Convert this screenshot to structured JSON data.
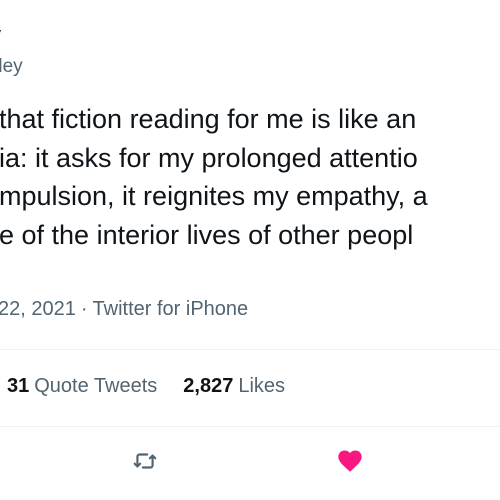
{
  "author": {
    "display_name": "y",
    "handle": "dey"
  },
  "body_lines": [
    "that fiction reading for me is like an",
    "ia: it asks for my prolonged attentio",
    "mpulsion, it reignites my empathy, a",
    "e of the interior lives of other peopl"
  ],
  "meta": {
    "date": "22, 2021",
    "separator": "·",
    "source": "Twitter for iPhone"
  },
  "stats": {
    "quote_tweets_count": "31",
    "quote_tweets_label": "Quote Tweets",
    "likes_count": "2,827",
    "likes_label": "Likes"
  },
  "actions": [
    {
      "name": "retweet",
      "icon": "retweet-icon",
      "color": "#536471"
    },
    {
      "name": "like",
      "icon": "heart-icon",
      "color": "#f91880",
      "active": true
    }
  ],
  "colors": {
    "text_primary": "#0f1419",
    "text_secondary": "#536471",
    "like_active": "#f91880",
    "divider": "#eff3f4"
  }
}
